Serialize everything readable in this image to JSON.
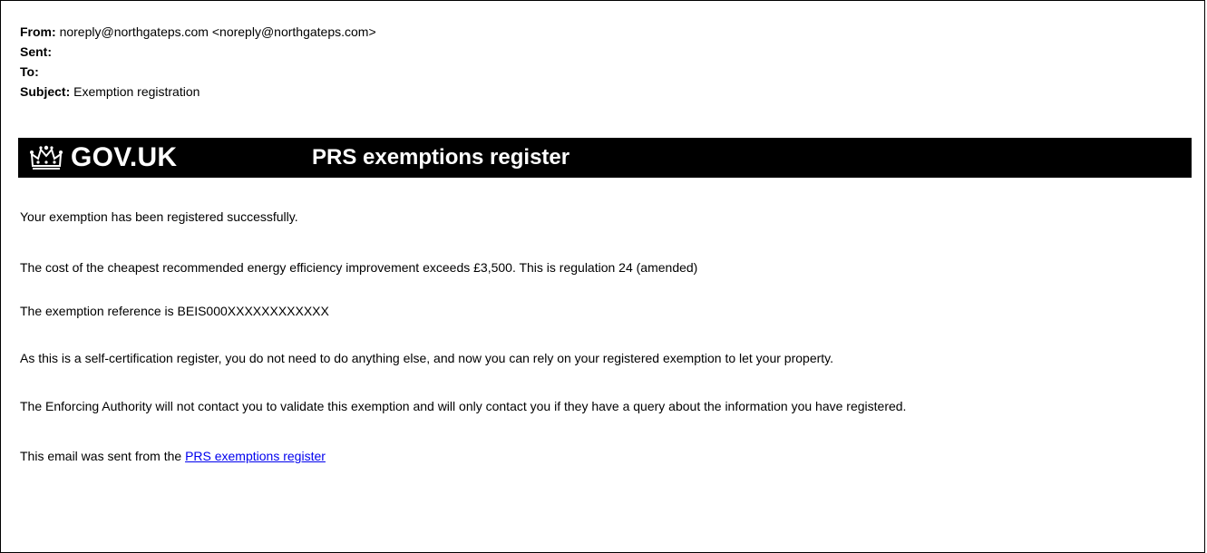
{
  "email": {
    "from_label": "From:",
    "from_value": "noreply@northgateps.com <noreply@northgateps.com>",
    "sent_label": "Sent:",
    "sent_value": "",
    "to_label": "To:",
    "to_value": "",
    "subject_label": "Subject:",
    "subject_value": "Exemption registration"
  },
  "banner": {
    "logo_text": "GOV.UK",
    "service_name": "PRS exemptions register",
    "background": "#000000",
    "text_color": "#ffffff"
  },
  "body": {
    "line1": "Your exemption has been registered successfully.",
    "line2": "The cost of the cheapest recommended energy efficiency improvement exceeds £3,500. This is regulation 24 (amended)",
    "line3": "The exemption reference is BEIS000XXXXXXXXXXXX",
    "line4": "As this is a self-certification register, you do not need to do anything else, and now you can rely on your registered exemption to let your property.",
    "line5": "The Enforcing Authority will not contact you to validate this exemption and will only contact you if they have a query about the information you have registered.",
    "footer_prefix": "This email was sent from the ",
    "footer_link": "PRS exemptions register"
  },
  "colors": {
    "link": "#0000ee"
  }
}
